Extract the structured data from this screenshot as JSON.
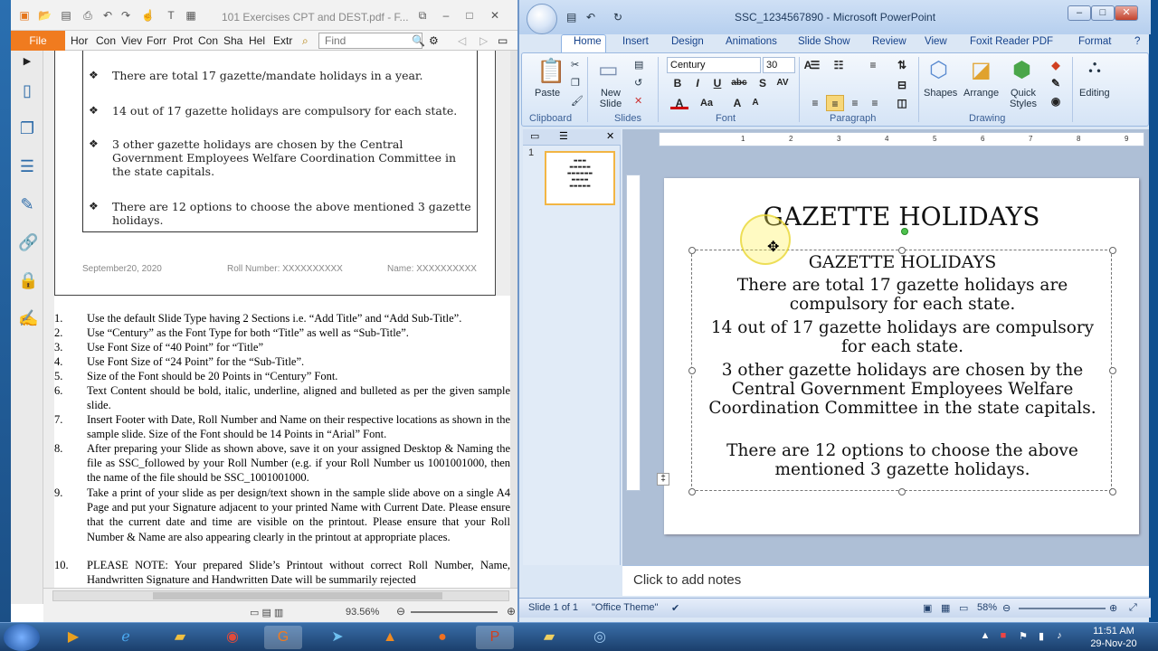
{
  "foxit": {
    "doc_title": "101 Exercises CPT and DEST.pdf - F...",
    "file_label": "File",
    "tabs": [
      "Hor",
      "Con",
      "Viev",
      "Forr",
      "Prot",
      "Con",
      "Sha",
      "Hel",
      "Extr"
    ],
    "find_placeholder": "Find",
    "zoom": "93.56%",
    "sample_slide": {
      "bullets": [
        "There are total 17 gazette/mandate holidays in a year.",
        "14 out of 17 gazette holidays are compulsory for each state.",
        "3 other gazette holidays are chosen by the Central Government Employees Welfare Coordination Committee in the state capitals.",
        "There are 12 options to choose the above mentioned 3 gazette holidays."
      ],
      "footer_date": "September20, 2020",
      "footer_roll": "Roll Number: XXXXXXXXXX",
      "footer_name": "Name: XXXXXXXXXX"
    },
    "instructions": [
      {
        "n": "1.",
        "text": "Use the default Slide Type having 2 Sections i.e. “Add Title” and “Add Sub-Title”."
      },
      {
        "n": "2.",
        "text": "Use “Century” as the Font Type for both “Title” as well as “Sub-Title”."
      },
      {
        "n": "3.",
        "text": "Use Font Size of “40 Point” for “Title”"
      },
      {
        "n": "4.",
        "text": "Use Font Size of “24 Point” for the “Sub-Title”."
      },
      {
        "n": "5.",
        "text": "Size of the Font should be 20 Points in “Century” Font."
      },
      {
        "n": "6.",
        "text": "Text Content should be bold, italic, underline, aligned and bulleted as per the given sample slide."
      },
      {
        "n": "7.",
        "text": "Insert Footer with Date, Roll Number and Name on their respective locations as shown in the sample slide. Size of the Font should be 14 Points in “Arial” Font."
      },
      {
        "n": "8.",
        "text": "After preparing your Slide as shown above, save it on your assigned Desktop & Naming the file as SSC_followed by your Roll Number (e.g. if your Roll Number us 1001001000, then the name of the file should be SSC_1001001000."
      },
      {
        "n": "9.",
        "text": "Take a print of your slide as per design/text shown in the sample slide above on a single A4 Page and put your Signature adjacent to your printed Name with Current Date. Please ensure that the current date and time are visible on the printout. Please ensure that your Roll Number & Name are also appearing clearly in the printout at appropriate places."
      },
      {
        "n": "10.",
        "text": "PLEASE NOTE: Your prepared Slide’s Printout without correct Roll Number, Name, Handwritten Signature and Handwritten Date will be summarily rejected"
      }
    ]
  },
  "ppt": {
    "window_title": "SSC_1234567890 - Microsoft PowerPoint",
    "tabs": [
      "Home",
      "Insert",
      "Design",
      "Animations",
      "Slide Show",
      "Review",
      "View",
      "Foxit Reader PDF",
      "Format"
    ],
    "ribbon": {
      "paste": "Paste",
      "new_slide": "New Slide",
      "font_name": "Century",
      "font_size": "30",
      "shapes": "Shapes",
      "arrange": "Arrange",
      "quick_styles": "Quick Styles",
      "editing": "Editing",
      "groups": [
        "Clipboard",
        "Slides",
        "Font",
        "Paragraph",
        "Drawing"
      ]
    },
    "ruler_numbers": [
      "1",
      "2",
      "3",
      "4",
      "5",
      "6",
      "7",
      "8",
      "9"
    ],
    "slide": {
      "title": "GAZETTE HOLIDAYS",
      "subtitle_heading": "GAZETTE HOLIDAYS",
      "paragraphs": [
        "There are total 17 gazette holidays are compulsory for each state.",
        "14 out of 17 gazette holidays are compulsory for each state.",
        "3 other gazette holidays are chosen by the Central Government Employees Welfare Coordination Committee in the state capitals.",
        "There are 12 options to choose the above mentioned 3 gazette holidays."
      ]
    },
    "notes_placeholder": "Click to add notes",
    "status": {
      "slide": "Slide 1 of 1",
      "theme": "\"Office Theme\"",
      "zoom": "58%"
    }
  },
  "taskbar": {
    "time": "11:51 AM",
    "date": "29-Nov-20"
  }
}
